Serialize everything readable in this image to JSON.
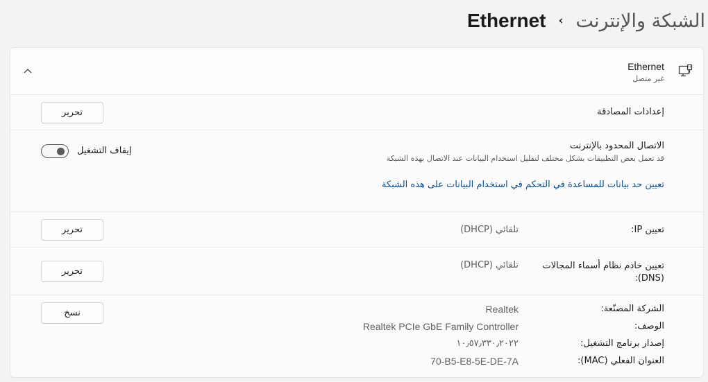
{
  "header": {
    "parent": "الشبكة والإنترنت",
    "separator": "›",
    "current": "Ethernet"
  },
  "adapter": {
    "name": "Ethernet",
    "status": "غير متصل",
    "icon": "ethernet-icon",
    "expanded": true
  },
  "auth": {
    "label": "إعدادات المصادقة",
    "button": "تحرير"
  },
  "metered": {
    "label": "الاتصال المحدود بالإنترنت",
    "description": "قد تعمل بعض التطبيقات بشكل مختلف لتقليل استخدام البيانات عند الاتصال بهذه الشبكة",
    "toggle_label": "إيقاف التشغيل",
    "toggle_on": false,
    "link": "تعيين حد بيانات للمساعدة في التحكم في استخدام البيانات على هذه الشبكة"
  },
  "ip": {
    "label": "تعيين IP:",
    "value": "تلقائي (DHCP)",
    "button": "تحرير"
  },
  "dns": {
    "label_line1": "تعيين خادم نظام أسماء المجالات",
    "label_line2": "(DNS):",
    "value": "تلقائي (DHCP)",
    "button": "تحرير"
  },
  "properties": {
    "button": "نسخ",
    "items": [
      {
        "label": "الشركة المصنّعة:",
        "value": "Realtek"
      },
      {
        "label": "الوصف:",
        "value": "Realtek PCIe GbE Family Controller"
      },
      {
        "label": "إصدار برنامج التشغيل:",
        "value": "١٠٫٥٧٫٣٣٠٫٢٠٢٢"
      },
      {
        "label": "العنوان الفعلي (MAC):",
        "value": "70-B5-E8-5E-DE-7A"
      }
    ]
  },
  "colors": {
    "background": "#f3f3f3",
    "panel": "#fbfbfb",
    "link": "#0a4f8f",
    "secondary_text": "#5f5f5f"
  }
}
